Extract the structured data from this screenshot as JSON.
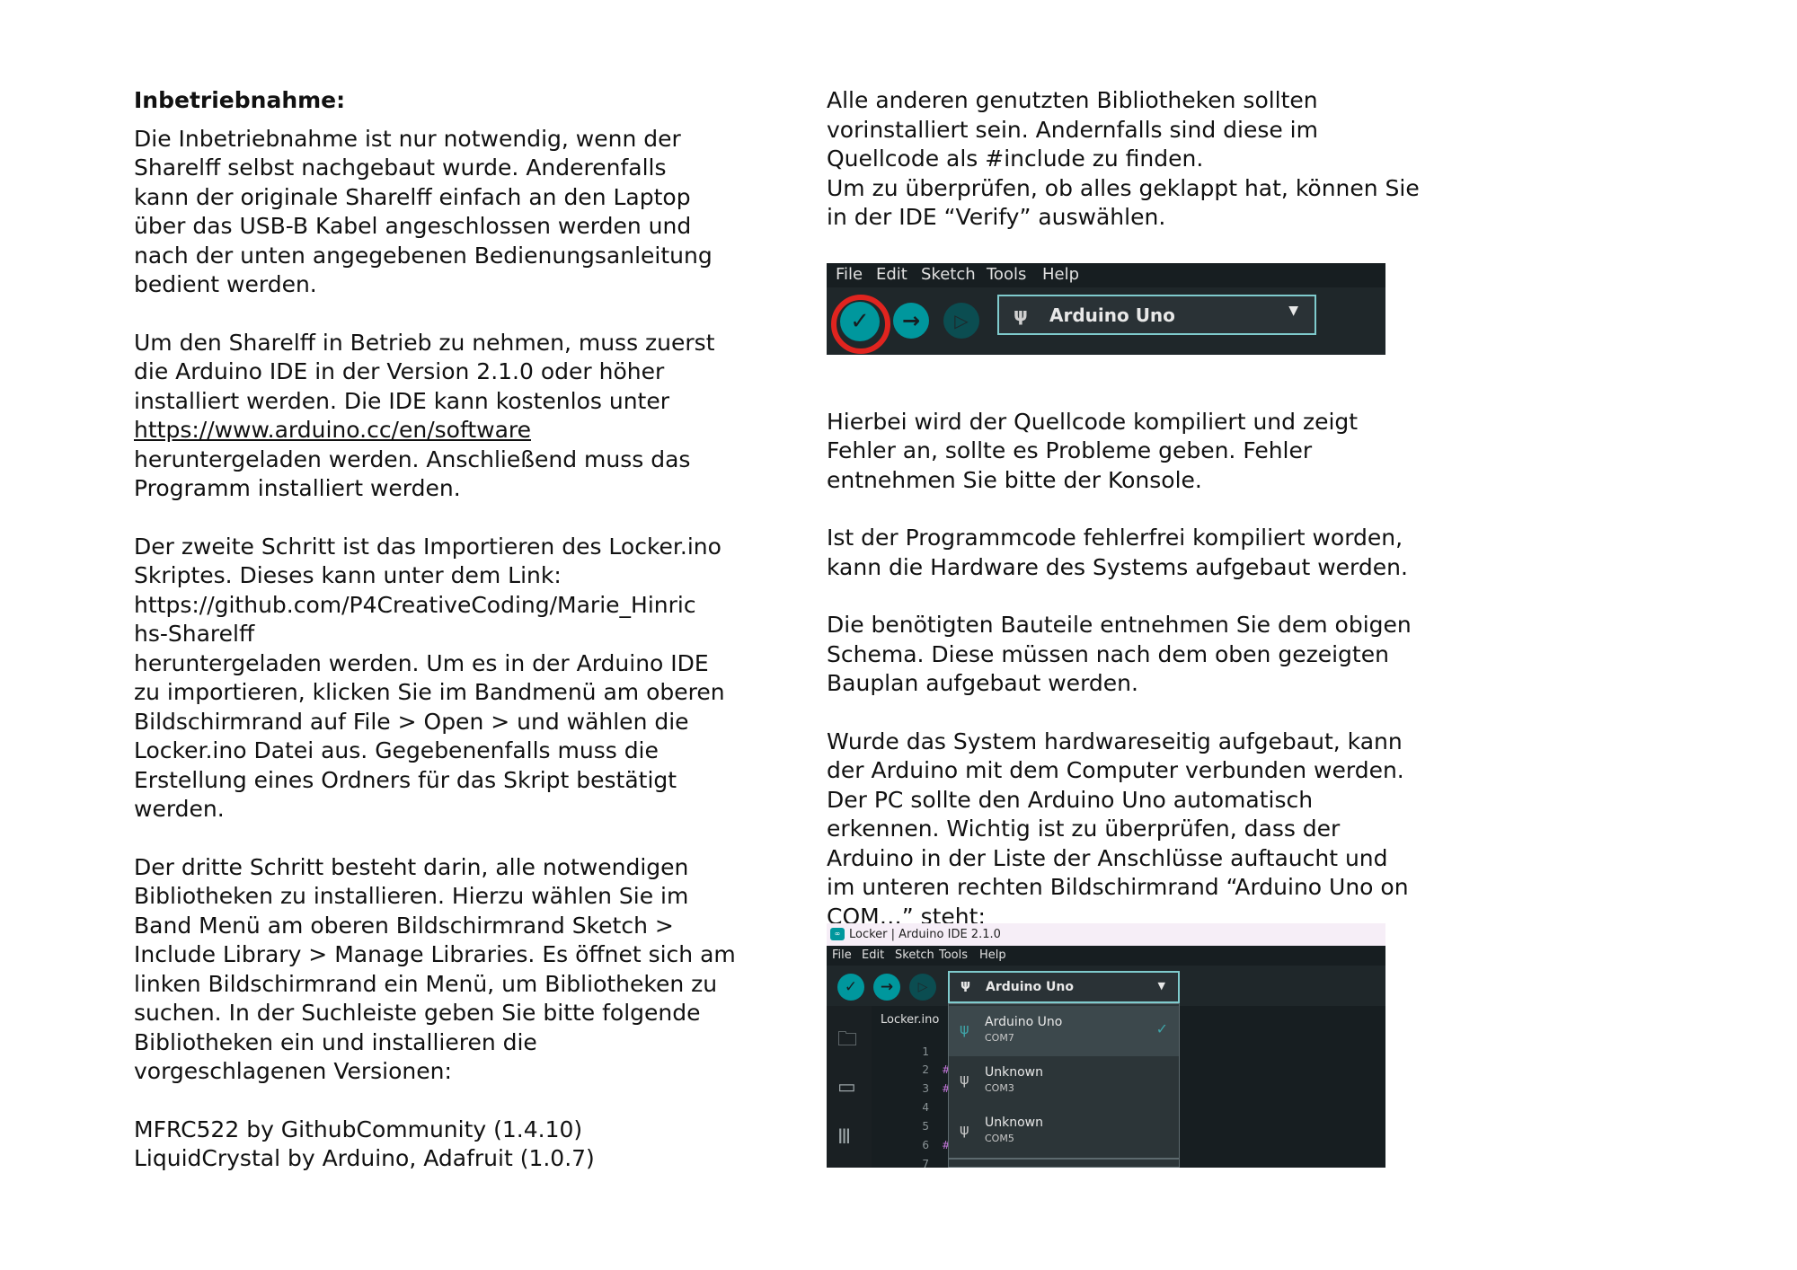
{
  "left": {
    "heading": "Inbetriebnahme:",
    "p1": [
      "Die Inbetriebnahme ist nur notwendig, wenn der",
      "Sharelff selbst nachgebaut wurde. Anderenfalls",
      "kann der originale Sharelff einfach an den Laptop",
      "über das USB-B Kabel angeschlossen werden und",
      "nach der unten angegebenen Bedienungsanleitung",
      "bedient werden."
    ],
    "p2": [
      "Um den Sharelff in Betrieb zu nehmen, muss zuerst",
      "die Arduino IDE in der Version 2.1.0 oder höher",
      "installiert werden. Die IDE kann kostenlos unter"
    ],
    "p2_link": "https://www.arduino.cc/en/software",
    "p2_after": [
      "heruntergeladen werden. Anschließend muss das",
      "Programm installiert werden."
    ],
    "p3": [
      "Der zweite Schritt ist das Importieren des Locker.ino",
      "Skriptes. Dieses kann unter dem Link:",
      "https://github.com/P4CreativeCoding/Marie_Hinric",
      "hs-Sharelff",
      "heruntergeladen werden. Um es in der Arduino IDE",
      "zu importieren, klicken Sie im Bandmenü am oberen",
      "Bildschirmrand auf File > Open > und wählen die",
      "Locker.ino Datei aus. Gegebenenfalls muss die",
      "Erstellung eines Ordners für das Skript bestätigt",
      "werden."
    ],
    "p4": [
      "Der dritte Schritt besteht darin, alle notwendigen",
      "Bibliotheken zu installieren. Hierzu wählen Sie im",
      "Band Menü am oberen Bildschirmrand Sketch >",
      "Include Library > Manage Libraries. Es öffnet sich am",
      "linken Bildschirmrand ein Menü, um Bibliotheken zu",
      "suchen. In der Suchleiste geben Sie bitte folgende",
      "Bibliotheken ein und installieren die",
      "vorgeschlagenen Versionen:"
    ],
    "libs": [
      "MFRC522 by GithubCommunity (1.4.10)",
      "LiquidCrystal by Arduino, Adafruit (1.0.7)"
    ]
  },
  "right": {
    "p1": [
      "Alle anderen genutzten Bibliotheken sollten",
      "vorinstalliert sein. Andernfalls sind diese im",
      "Quellcode als #include zu finden.",
      "Um zu überprüfen, ob alles geklappt hat, können Sie",
      "in der IDE “Verify” auswählen."
    ],
    "p2": [
      "Hierbei wird der Quellcode kompiliert und zeigt",
      "Fehler an, sollte es Probleme geben. Fehler",
      "entnehmen Sie bitte der Konsole."
    ],
    "p3": [
      "Ist der Programmcode fehlerfrei kompiliert worden,",
      "kann die Hardware des Systems aufgebaut werden."
    ],
    "p4": [
      "Die benötigten Bauteile entnehmen Sie dem obigen",
      "Schema. Diese müssen nach dem oben gezeigten",
      "Bauplan aufgebaut werden."
    ],
    "p5": [
      "Wurde das System hardwareseitig aufgebaut, kann",
      "der Arduino mit dem Computer verbunden werden.",
      "Der PC sollte den Arduino Uno automatisch",
      "erkennen. Wichtig ist zu überprüfen, dass der",
      "Arduino in der Liste der Anschlüsse auftaucht und",
      "im unteren rechten Bildschirmrand “Arduino Uno on",
      "COM…” steht:"
    ]
  },
  "shot1": {
    "menu": [
      "File",
      "Edit",
      "Sketch",
      "Tools",
      "Help"
    ],
    "board": "Arduino Uno"
  },
  "shot2": {
    "title": "Locker | Arduino IDE 2.1.0",
    "menu": [
      "File",
      "Edit",
      "Sketch",
      "Tools",
      "Help"
    ],
    "board": "Arduino Uno",
    "file_tab": "Locker.ino",
    "line_numbers": [
      "1",
      "2",
      "3",
      "4",
      "5",
      "6",
      "7"
    ],
    "options": [
      {
        "name": "Arduino Uno",
        "port": "COM7"
      },
      {
        "name": "Unknown",
        "port": "COM3"
      },
      {
        "name": "Unknown",
        "port": "COM5"
      }
    ]
  },
  "colors": {
    "accent": "#00979d",
    "highlight_ring": "#e0241f",
    "ide_bg": "#1f272a"
  }
}
